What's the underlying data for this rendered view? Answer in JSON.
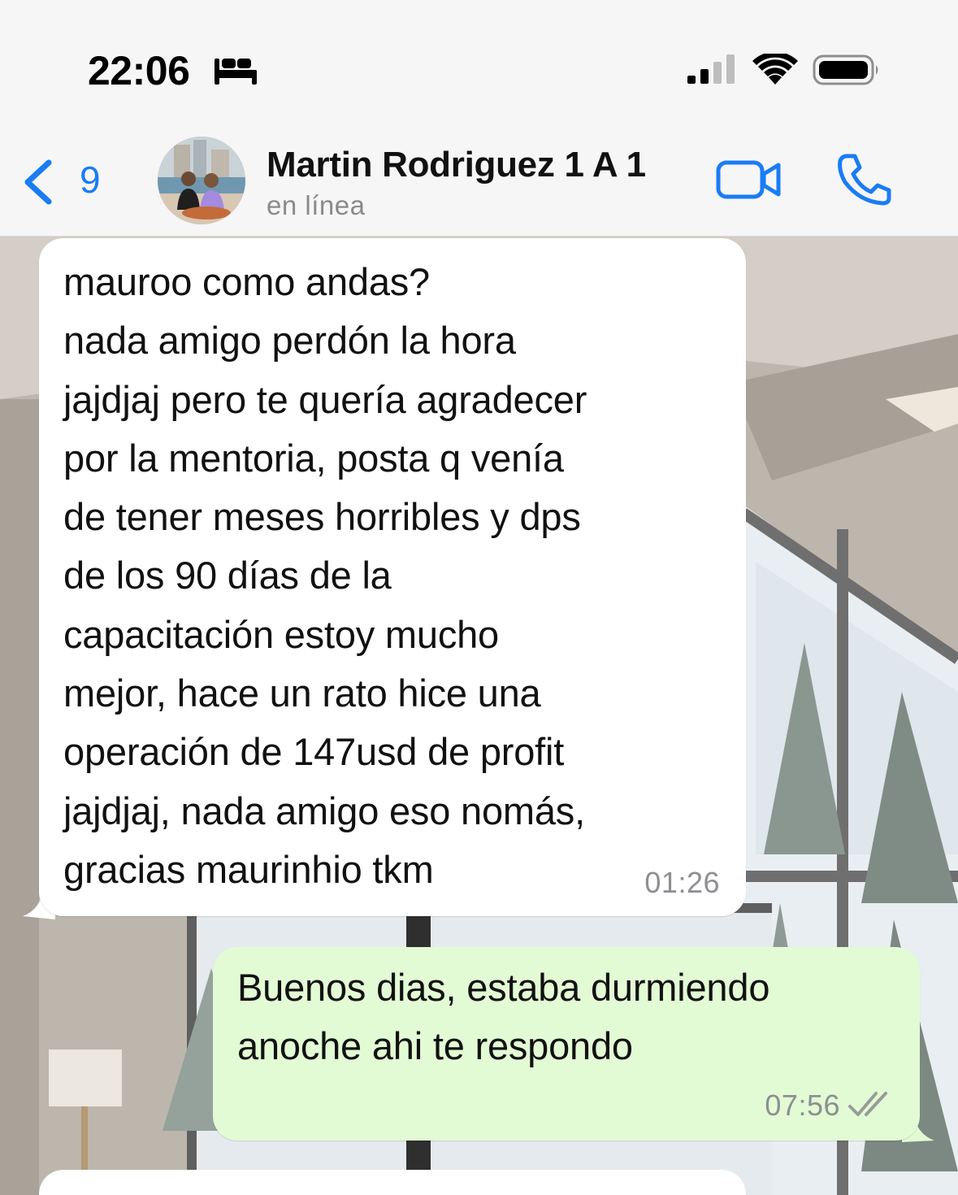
{
  "status_bar": {
    "time": "22:06",
    "icons": [
      "bed-icon",
      "signal-icon",
      "wifi-icon",
      "battery-icon"
    ]
  },
  "header": {
    "back_count": "9",
    "contact_name": "Martin Rodriguez 1 A 1",
    "contact_status": "en línea",
    "accent_color": "#1a7cf5",
    "icons": [
      "back-chevron-icon",
      "video-call-icon",
      "phone-call-icon"
    ]
  },
  "messages": [
    {
      "direction": "incoming",
      "text": "mauroo como andas?\nnada amigo perdón la hora\njajdjaj pero te quería agradecer\npor la mentoria, posta q venía\nde tener meses horribles y dps\nde los 90 días de la\ncapacitación estoy mucho\nmejor, hace un rato hice una\noperación de 147usd de profit\njajdjaj, nada amigo eso nomás,\ngracias maurinhio tkm",
      "time": "01:26",
      "bubble_color": "#ffffff"
    },
    {
      "direction": "outgoing",
      "text": "Buenos dias, estaba durmiendo\nanoche ahi te respondo",
      "time": "07:56",
      "status": "read",
      "bubble_color": "#e2fbd4"
    }
  ]
}
